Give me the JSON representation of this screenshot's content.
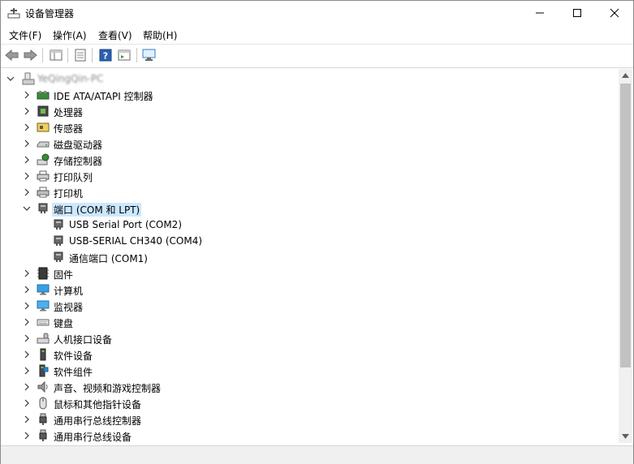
{
  "window": {
    "title": "设备管理器",
    "computer_name": "YeQingQin-PC"
  },
  "menu": {
    "file": "文件(F)",
    "action": "操作(A)",
    "view": "查看(V)",
    "help": "帮助(H)"
  },
  "tree": {
    "items": [
      {
        "label": "IDE ATA/ATAPI 控制器",
        "icon": "ide-controller-icon"
      },
      {
        "label": "处理器",
        "icon": "processor-icon"
      },
      {
        "label": "传感器",
        "icon": "sensor-icon"
      },
      {
        "label": "磁盘驱动器",
        "icon": "disk-drive-icon"
      },
      {
        "label": "存储控制器",
        "icon": "storage-controller-icon"
      },
      {
        "label": "打印队列",
        "icon": "print-queue-icon"
      },
      {
        "label": "打印机",
        "icon": "printer-icon"
      },
      {
        "label": "端口 (COM 和 LPT)",
        "icon": "port-icon",
        "expanded": true,
        "selected": true,
        "children": [
          {
            "label": "USB Serial Port (COM2)"
          },
          {
            "label": "USB-SERIAL CH340 (COM4)"
          },
          {
            "label": "通信端口 (COM1)"
          }
        ]
      },
      {
        "label": "固件",
        "icon": "firmware-icon"
      },
      {
        "label": "计算机",
        "icon": "computer-icon"
      },
      {
        "label": "监视器",
        "icon": "monitor-icon"
      },
      {
        "label": "键盘",
        "icon": "keyboard-icon"
      },
      {
        "label": "人机接口设备",
        "icon": "hid-icon"
      },
      {
        "label": "软件设备",
        "icon": "software-device-icon"
      },
      {
        "label": "软件组件",
        "icon": "software-component-icon"
      },
      {
        "label": "声音、视频和游戏控制器",
        "icon": "sound-icon"
      },
      {
        "label": "鼠标和其他指针设备",
        "icon": "mouse-icon"
      },
      {
        "label": "通用串行总线控制器",
        "icon": "usb-controller-icon"
      },
      {
        "label": "通用串行总线设备",
        "icon": "usb-device-icon"
      }
    ]
  },
  "colors": {
    "selection": "#cce8ff",
    "accent": "#2a6fd1"
  }
}
